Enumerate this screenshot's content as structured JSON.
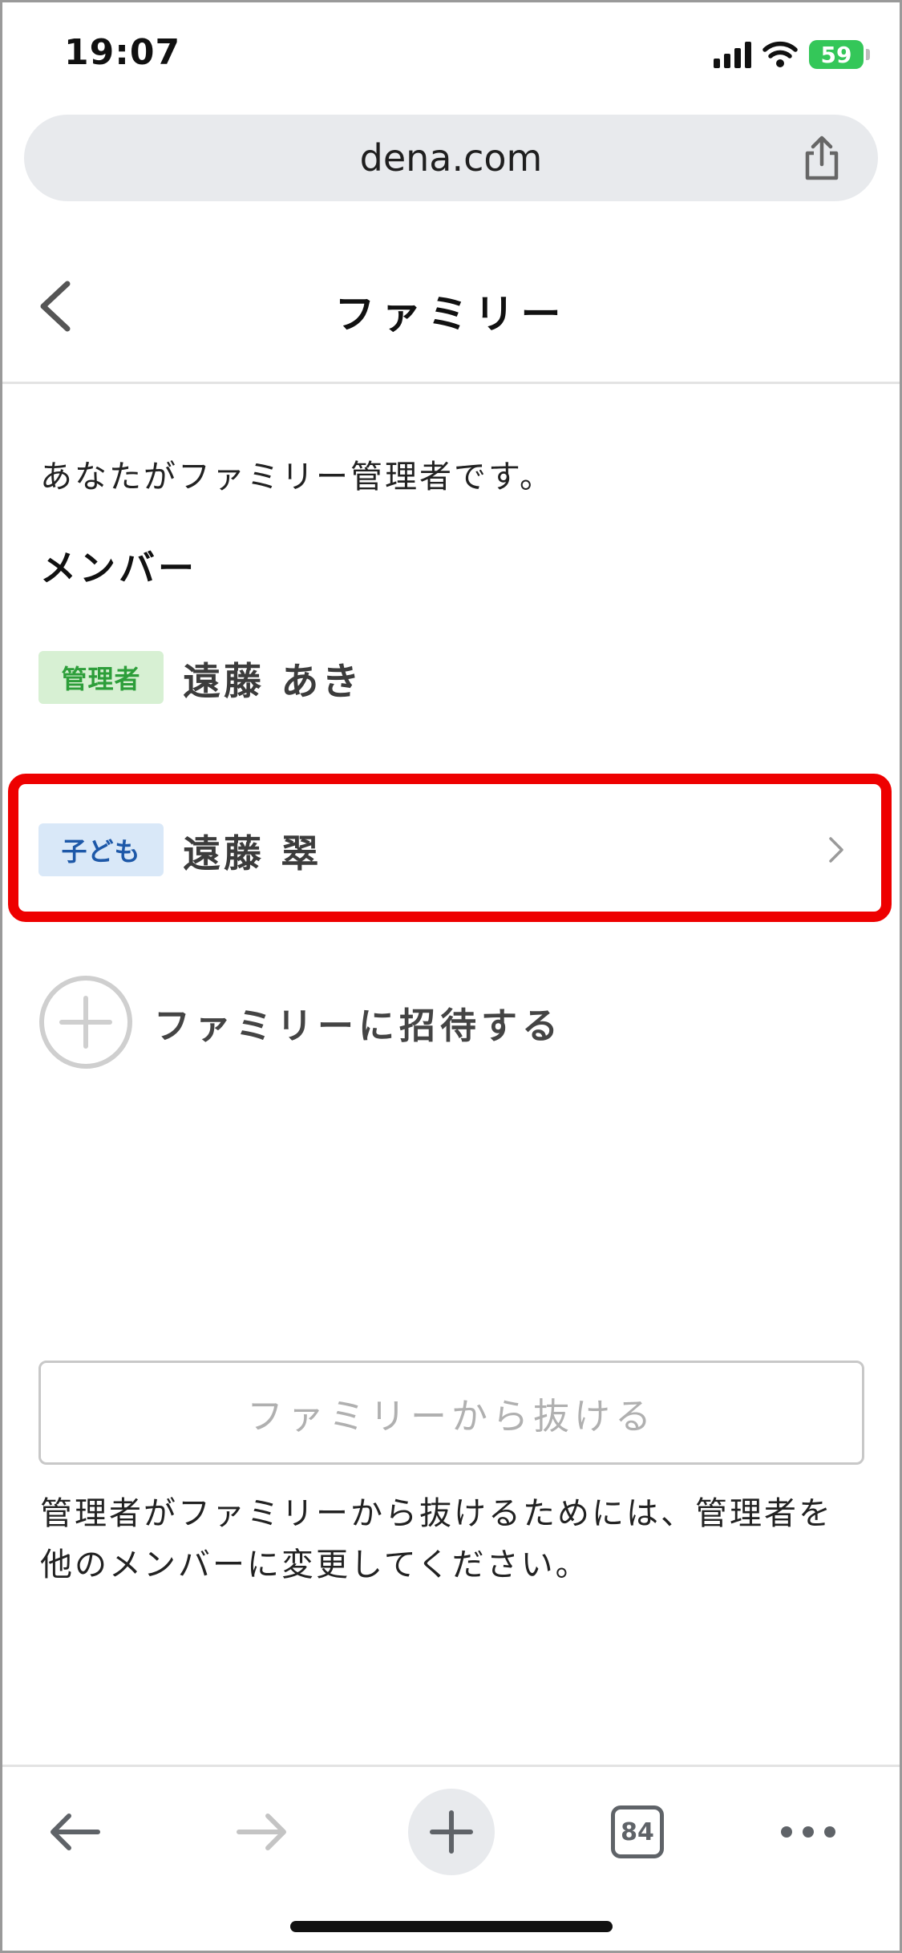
{
  "status_bar": {
    "time": "19:07",
    "battery": "59"
  },
  "browser": {
    "url": "dena.com",
    "tab_count": "84"
  },
  "header": {
    "title": "ファミリー"
  },
  "intro": "あなたがファミリー管理者です。",
  "members_heading": "メンバー",
  "members": [
    {
      "role": "管理者",
      "name": "遠藤 あき"
    },
    {
      "role": "子ども",
      "name": "遠藤 翠"
    }
  ],
  "invite_label": "ファミリーに招待する",
  "leave_button": "ファミリーから抜ける",
  "leave_note": "管理者がファミリーから抜けるためには、管理者を他のメンバーに変更してください。",
  "colors": {
    "highlight": "#ee0000",
    "admin_badge_bg": "#d7f0d3",
    "admin_badge_text": "#2d9e3a",
    "child_badge_bg": "#d9e8f8",
    "child_badge_text": "#1d58a8",
    "battery": "#34c759"
  },
  "icons": [
    "signal-icon",
    "wifi-icon",
    "battery-icon",
    "share-icon",
    "back-chevron-icon",
    "chevron-right-icon",
    "plus-circle-icon",
    "arrow-left-icon",
    "arrow-right-icon",
    "plus-icon",
    "more-icon"
  ]
}
